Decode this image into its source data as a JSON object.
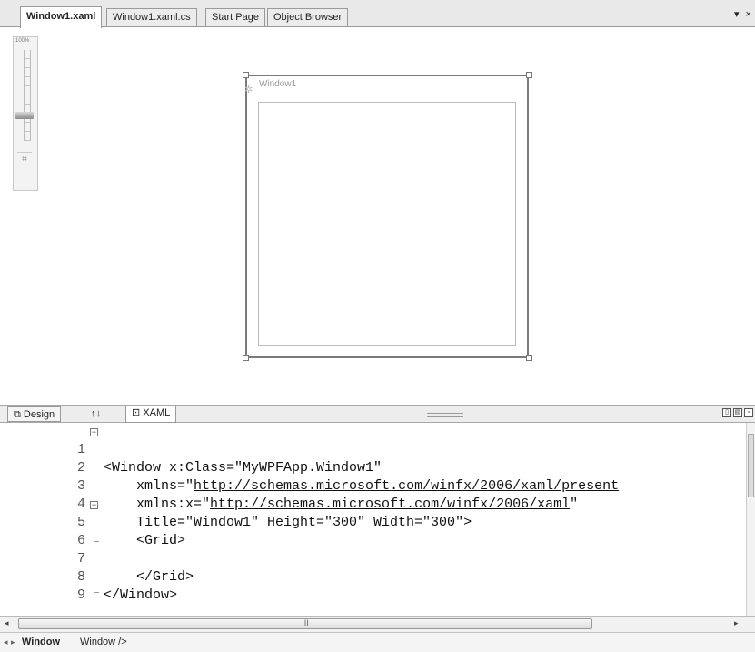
{
  "doc_tabs": [
    {
      "label": "Window1.xaml",
      "active": true
    },
    {
      "label": "Window1.xaml.cs",
      "active": false
    },
    {
      "label": "Start Page",
      "active": false
    },
    {
      "label": "Object Browser",
      "active": false
    }
  ],
  "doc_tabs_right": "▾ ×",
  "zoom": {
    "label": "100%",
    "fit_icon": "fit-to-window-icon"
  },
  "design_window": {
    "title": "Window1"
  },
  "split_tabs": {
    "design": "Design",
    "swap": "↑↓",
    "xaml": "XAML",
    "xaml_icon": "xaml-doc-icon",
    "design_icon": "design-view-icon"
  },
  "code_lines": [
    {
      "n": "1",
      "pre": "<Window x:Class=\"MyWPFApp.Window1\"",
      "link": "",
      "post": ""
    },
    {
      "n": "2",
      "pre": "    xmlns=\"",
      "link": "http://schemas.microsoft.com/winfx/2006/xaml/present",
      "post": ""
    },
    {
      "n": "3",
      "pre": "    xmlns:x=\"",
      "link": "http://schemas.microsoft.com/winfx/2006/xaml",
      "post": "\""
    },
    {
      "n": "4",
      "pre": "    Title=\"Window1\" Height=\"300\" Width=\"300\">",
      "link": "",
      "post": ""
    },
    {
      "n": "5",
      "pre": "    <Grid>",
      "link": "",
      "post": ""
    },
    {
      "n": "6",
      "pre": "",
      "link": "",
      "post": ""
    },
    {
      "n": "7",
      "pre": "    </Grid>",
      "link": "",
      "post": ""
    },
    {
      "n": "8",
      "pre": "</Window>",
      "link": "",
      "post": ""
    },
    {
      "n": "9",
      "pre": "",
      "link": "",
      "post": ""
    }
  ],
  "h_scroll_grip": "III",
  "status": {
    "element": "Window",
    "tag": "Window />"
  }
}
